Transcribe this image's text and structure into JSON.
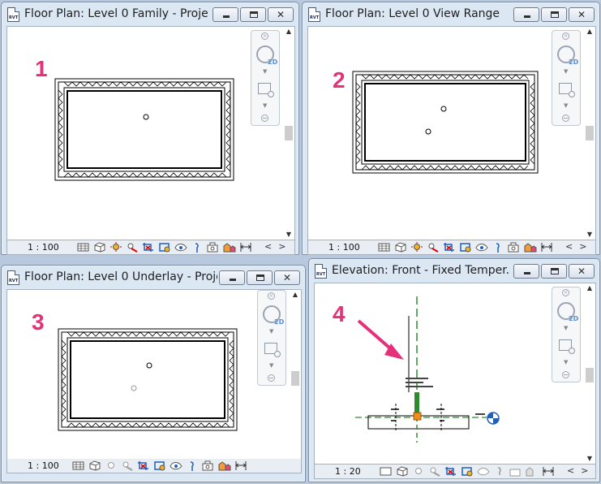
{
  "windows": [
    {
      "title": "Floor Plan: Level 0 Family - Proje...",
      "scale": "1 : 100",
      "step_label": "1"
    },
    {
      "title": "Floor Plan: Level 0 View Range -...",
      "scale": "1 : 100",
      "step_label": "2"
    },
    {
      "title": "Floor Plan: Level 0 Underlay - Proje...",
      "scale": "1 : 100",
      "step_label": "3"
    },
    {
      "title": "Elevation: Front - Fixed Temper...",
      "scale": "1 : 20",
      "step_label": "4"
    }
  ],
  "app_icon_text": "RVT",
  "colors": {
    "accent": "#e5307a",
    "ref_line": "#2e8b2e",
    "section": "#1f5fbf"
  }
}
